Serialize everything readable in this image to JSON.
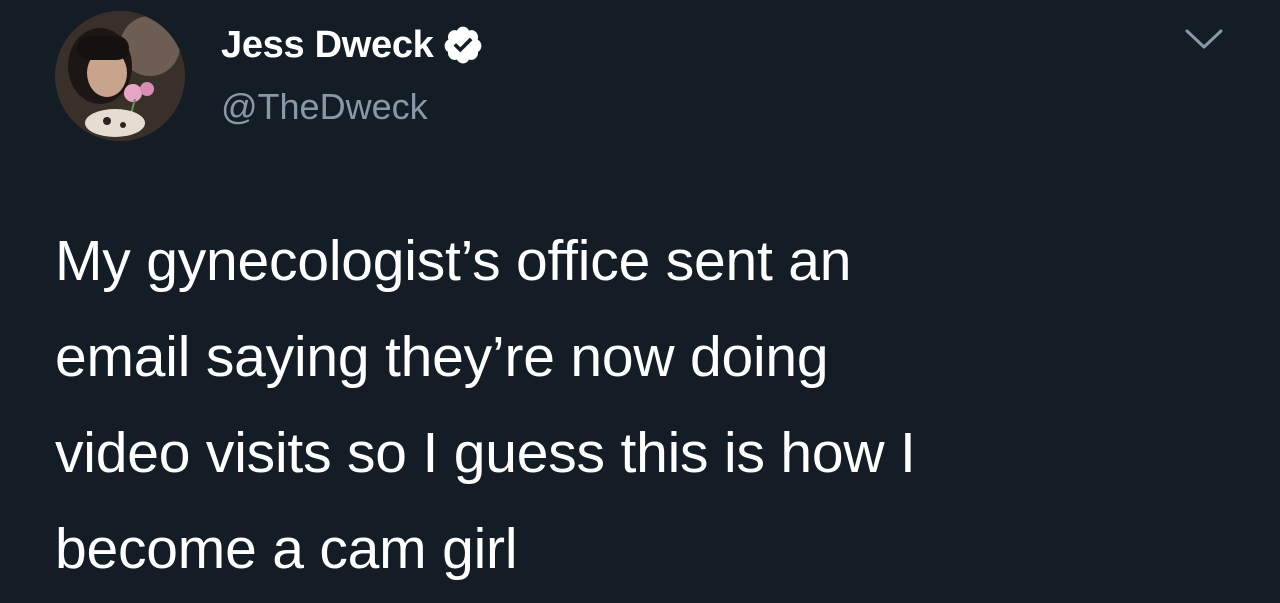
{
  "author": {
    "display_name": "Jess Dweck",
    "handle": "@TheDweck",
    "verified": true
  },
  "icons": {
    "verified": "verified-badge-icon",
    "menu": "chevron-down-icon"
  },
  "tweet": {
    "lines": [
      "My gynecologist’s office sent an",
      "email saying they’re now doing",
      "video visits so I guess this is how I",
      "become a cam girl"
    ]
  },
  "colors": {
    "background": "#141d26",
    "text": "#ffffff",
    "secondary_text": "#8899a6"
  }
}
